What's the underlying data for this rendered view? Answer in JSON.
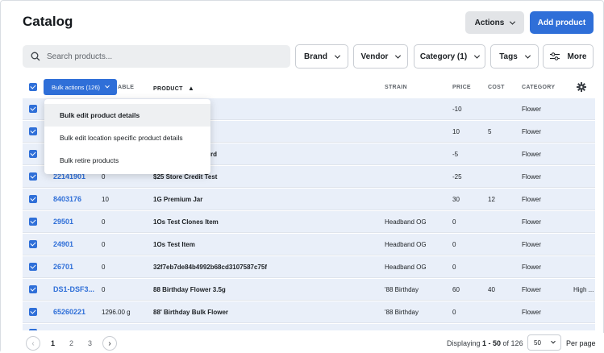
{
  "header": {
    "title": "Catalog",
    "actions_label": "Actions",
    "add_product_label": "Add product"
  },
  "search": {
    "placeholder": "Search products..."
  },
  "filters": [
    {
      "label": "Brand"
    },
    {
      "label": "Vendor"
    },
    {
      "label": "Category (1)"
    },
    {
      "label": "Tags"
    },
    {
      "label": "More"
    }
  ],
  "table": {
    "bulk_actions_label": "Bulk actions (126)",
    "columns": {
      "available_partial": "ABLE",
      "product": "PRODUCT",
      "strain": "STRAIN",
      "price": "PRICE",
      "cost": "COST",
      "category": "CATEGORY"
    },
    "rows": [
      {
        "sku": "",
        "available": "",
        "product": "",
        "strain": "",
        "price": "-10",
        "cost": "",
        "category": "Flower",
        "extra": ""
      },
      {
        "sku": "",
        "available": "",
        "product": "",
        "strain": "",
        "price": "10",
        "cost": "5",
        "category": "Flower",
        "extra": ""
      },
      {
        "sku": "",
        "available": "",
        "product": "rd",
        "strain": "",
        "price": "-5",
        "cost": "",
        "category": "Flower",
        "extra": ""
      },
      {
        "sku": "22141901",
        "available": "0",
        "product": "$25 Store Credit Test",
        "strain": "",
        "price": "-25",
        "cost": "",
        "category": "Flower",
        "extra": ""
      },
      {
        "sku": "8403176",
        "available": "10",
        "product": "1G Premium Jar",
        "strain": "",
        "price": "30",
        "cost": "12",
        "category": "Flower",
        "extra": ""
      },
      {
        "sku": "29501",
        "available": "0",
        "product": "1Os Test Clones Item",
        "strain": "Headband OG",
        "price": "0",
        "cost": "",
        "category": "Flower",
        "extra": ""
      },
      {
        "sku": "24901",
        "available": "0",
        "product": "1Os Test Item",
        "strain": "Headband OG",
        "price": "0",
        "cost": "",
        "category": "Flower",
        "extra": ""
      },
      {
        "sku": "26701",
        "available": "0",
        "product": "32f7eb7de84b4992b68cd3107587c75f",
        "strain": "Headband OG",
        "price": "0",
        "cost": "",
        "category": "Flower",
        "extra": ""
      },
      {
        "sku": "DS1-DSF3...",
        "available": "0",
        "product": "88 Birthday Flower 3.5g",
        "strain": "'88 Birthday",
        "price": "60",
        "cost": "40",
        "category": "Flower",
        "extra": "High ..."
      },
      {
        "sku": "65260221",
        "available": "1296.00 g",
        "product": "88' Birthday Bulk Flower",
        "strain": "'88 Birthday",
        "price": "0",
        "cost": "",
        "category": "Flower",
        "extra": ""
      }
    ]
  },
  "bulk_menu": {
    "items": [
      {
        "label": "Bulk edit product details"
      },
      {
        "label": "Bulk edit location specific product details"
      },
      {
        "label": "Bulk retire products"
      }
    ]
  },
  "pagination": {
    "pages": [
      "1",
      "2",
      "3"
    ],
    "current": "1",
    "display_prefix": "Displaying ",
    "display_range": "1 - 50",
    "display_suffix": " of 126",
    "per_page_value": "50",
    "per_page_label": "Per page"
  },
  "colors": {
    "accent": "#2f6fd8",
    "row_selected": "#e9eff9"
  }
}
